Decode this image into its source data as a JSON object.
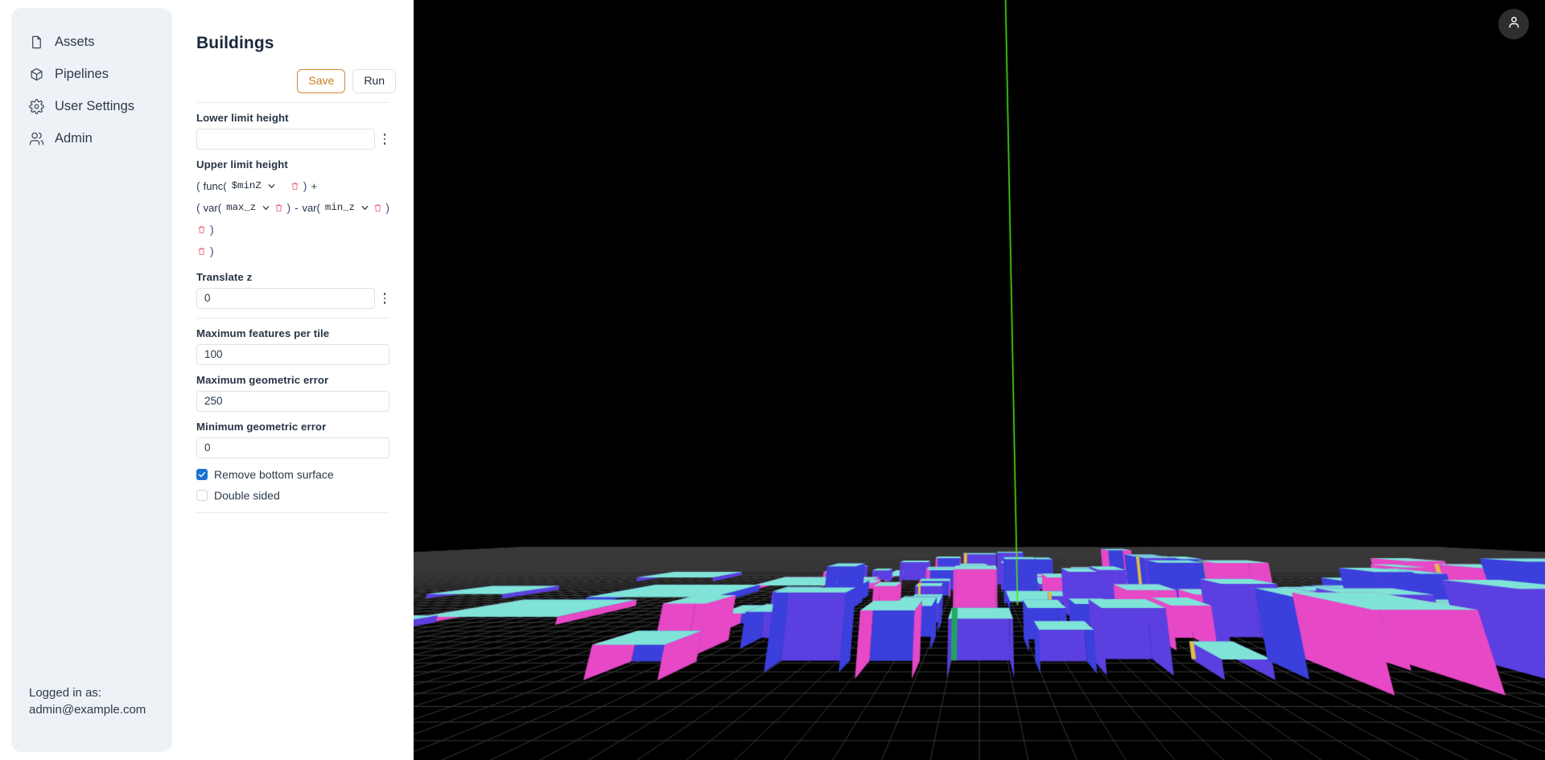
{
  "sidebar": {
    "items": [
      {
        "label": "Assets",
        "icon": "file-icon"
      },
      {
        "label": "Pipelines",
        "icon": "cube-icon"
      },
      {
        "label": "User Settings",
        "icon": "gear-icon"
      },
      {
        "label": "Admin",
        "icon": "users-icon"
      }
    ],
    "footer": {
      "logged_in_label": "Logged in as:",
      "user_email": "admin@example.com"
    }
  },
  "panel": {
    "title": "Buildings",
    "save_label": "Save",
    "run_label": "Run",
    "fields": {
      "lower_limit": {
        "label": "Lower limit height",
        "value": "",
        "placeholder": ""
      },
      "upper_limit": {
        "label": "Upper limit height"
      },
      "translate_z": {
        "label": "Translate z",
        "value": "0"
      },
      "max_features": {
        "label": "Maximum features per tile",
        "value": "100"
      },
      "max_geometric_error": {
        "label": "Maximum geometric error",
        "value": "250"
      },
      "min_geometric_error": {
        "label": "Minimum geometric error",
        "value": "0"
      }
    },
    "expression": {
      "line1": {
        "open": "(",
        "fn": "func(",
        "token": "$minZ",
        "close": ")",
        "operator": "+"
      },
      "line2": {
        "open": "(",
        "fn_a": "var(",
        "token_a": "max_z",
        "close_a": ")",
        "operator": "-",
        "fn_b": "var(",
        "token_b": "min_z",
        "close_b": ")"
      },
      "line3": {
        "close": ")"
      },
      "line4": {
        "close": ")"
      }
    },
    "checkboxes": [
      {
        "label": "Remove bottom surface",
        "checked": true
      },
      {
        "label": "Double sided",
        "checked": false
      }
    ]
  },
  "viewport": {
    "avatar_icon": "person-icon",
    "colors": {
      "background": "#000000",
      "grid": "#3a3a3a",
      "roof_cyan": "#7fe3d8",
      "face_magenta": "#e648c6",
      "face_blue": "#3b3fdc",
      "face_violet": "#5b3fe0",
      "accent_yellow": "#e8c341",
      "accent_green": "#1fa85c",
      "axis_green": "#44ee11"
    }
  }
}
